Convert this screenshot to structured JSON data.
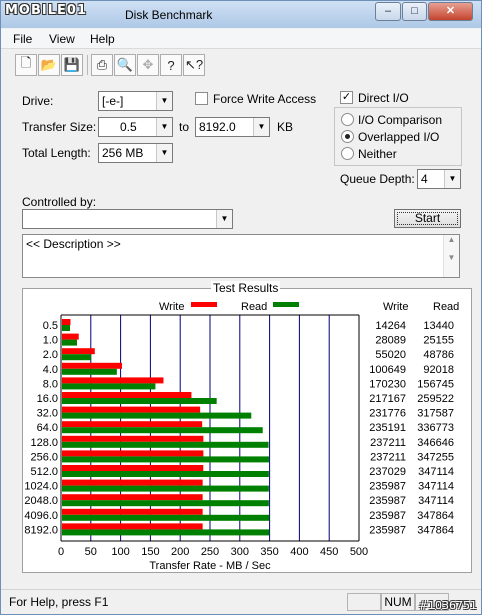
{
  "window": {
    "brand": "MOBILE01",
    "title": "Disk Benchmark",
    "min": "–",
    "max": "□",
    "close": "✕"
  },
  "menu": [
    "File",
    "View",
    "Help"
  ],
  "toolbar": {
    "icons": [
      "new-icon",
      "open-icon",
      "save-icon",
      "print-icon",
      "print-preview-icon",
      "move-icon",
      "help-icon",
      "context-help-icon"
    ]
  },
  "form": {
    "drive_label": "Drive:",
    "drive_value": "[-e-]",
    "transfer_label": "Transfer Size:",
    "transfer_from": "0.5",
    "to_label": "to",
    "transfer_to": "8192.0",
    "kb_label": "KB",
    "total_label": "Total Length:",
    "total_value": "256 MB",
    "force_write": "Force Write Access",
    "force_write_checked": false,
    "direct_io": "Direct I/O",
    "direct_io_checked": true,
    "radio_io_comparison": "I/O Comparison",
    "radio_overlapped": "Overlapped I/O",
    "radio_neither": "Neither",
    "selected_radio": "Overlapped I/O",
    "queue_label": "Queue Depth:",
    "queue_value": "4",
    "controlled_label": "Controlled by:",
    "controlled_value": "",
    "start_button": "Start",
    "description": "<< Description >>"
  },
  "results": {
    "group_title": "Test Results",
    "legend_write": "Write",
    "legend_read": "Read",
    "col_write": "Write",
    "col_read": "Read",
    "write_color": "#ff0000",
    "read_color": "#008000"
  },
  "chart_data": {
    "type": "bar",
    "categories": [
      "0.5",
      "1.0",
      "2.0",
      "4.0",
      "8.0",
      "16.0",
      "32.0",
      "64.0",
      "128.0",
      "256.0",
      "512.0",
      "1024.0",
      "2048.0",
      "4096.0",
      "8192.0"
    ],
    "series": [
      {
        "name": "Write",
        "values": [
          14264,
          28089,
          55020,
          100649,
          170230,
          217167,
          231776,
          235191,
          237211,
          237211,
          237029,
          235987,
          235987,
          235987,
          235987
        ]
      },
      {
        "name": "Read",
        "values": [
          13440,
          25155,
          48786,
          92018,
          156745,
          259522,
          317587,
          336773,
          346646,
          347255,
          347114,
          347114,
          347114,
          347864,
          347864
        ]
      }
    ],
    "xlabel": "Transfer Rate - MB / Sec",
    "xlim": [
      0,
      500
    ],
    "xticks": [
      "0",
      "50",
      "100",
      "150",
      "200",
      "250",
      "300",
      "350",
      "400",
      "450",
      "500"
    ],
    "orientation": "horizontal",
    "grid": true
  },
  "status": {
    "text": "For Help, press F1",
    "num": "NUM"
  },
  "watermark": "#1036751"
}
